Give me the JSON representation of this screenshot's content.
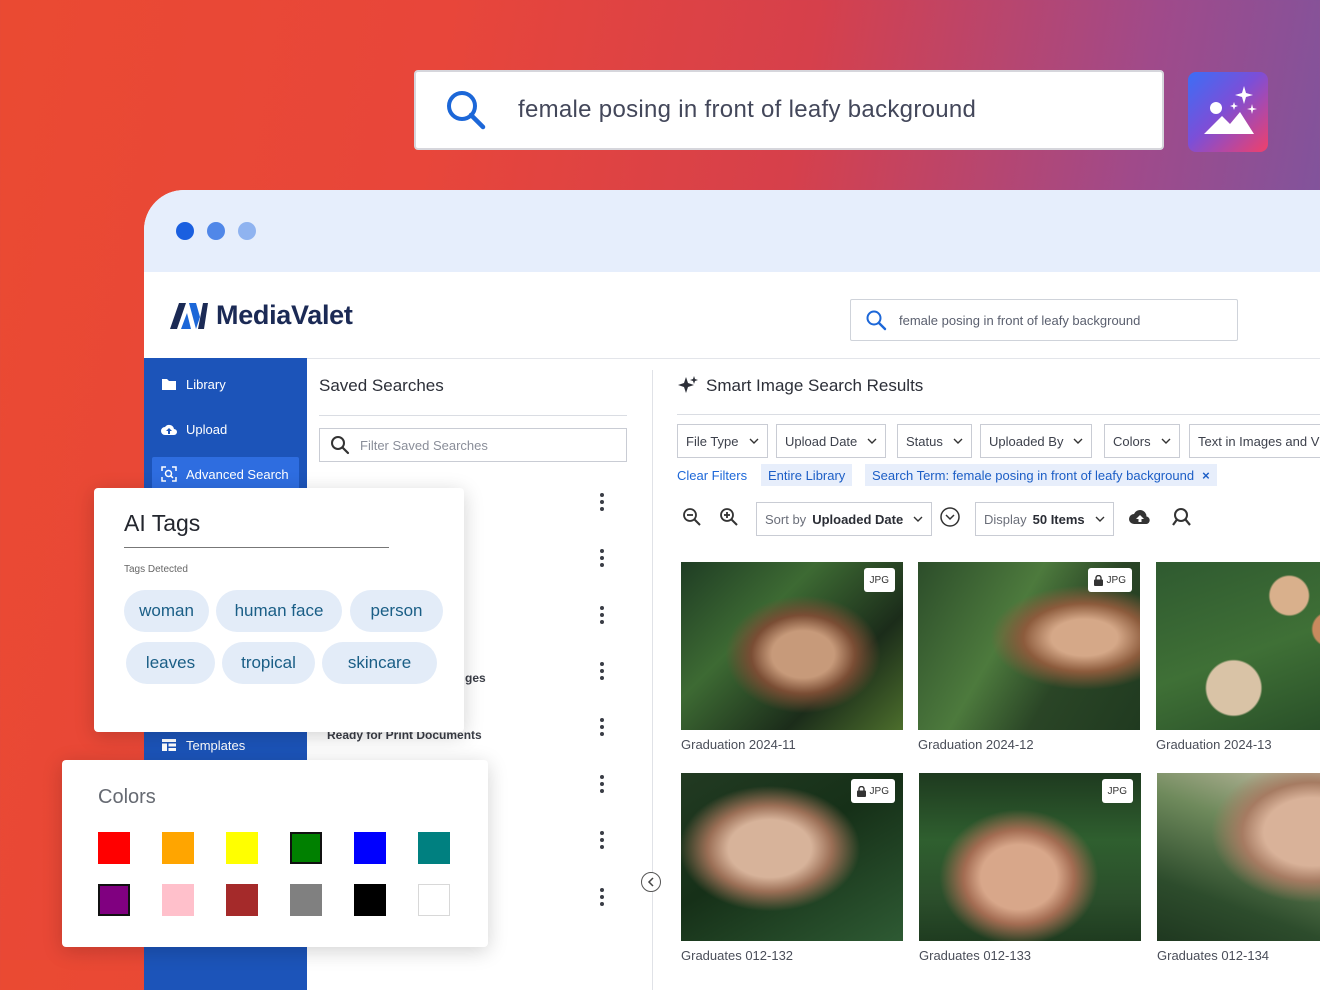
{
  "hero": {
    "search_text": "female posing in front of leafy background",
    "icon": "search-icon",
    "ai_icon": "ai-image-search-icon"
  },
  "window": {
    "dots": [
      "#1a5fe0",
      "#5087e8",
      "#8fb3f0"
    ],
    "brand": "MediaValet",
    "header_search_text": "female posing in front of leafy background"
  },
  "sidebar": {
    "items": [
      {
        "label": "Library",
        "icon": "folder-icon"
      },
      {
        "label": "Upload",
        "icon": "cloud-upload-icon"
      },
      {
        "label": "Advanced Search",
        "icon": "advanced-search-icon"
      },
      {
        "label": "Templates",
        "icon": "templates-icon"
      }
    ]
  },
  "saved": {
    "title": "Saved Searches",
    "filter_placeholder": "Filter Saved Searches",
    "partial_item_1": "ges",
    "partial_item_2": "Ready for Print Documents"
  },
  "results": {
    "title": "Smart Image Search Results",
    "filters": [
      "File Type",
      "Upload Date",
      "Status",
      "Uploaded By",
      "Colors",
      "Text in Images and V"
    ],
    "clear_filters": "Clear Filters",
    "chip_library": "Entire Library",
    "chip_search_term": "Search Term: female posing in front of leafy background",
    "chip_remove": "×",
    "sort_prefix": "Sort by",
    "sort_value": "Uploaded Date",
    "display_prefix": "Display",
    "display_value": "50 Items",
    "assets": [
      {
        "name": "Graduation 2024-11",
        "badge": "JPG",
        "locked": false
      },
      {
        "name": "Graduation 2024-12",
        "badge": "JPG",
        "locked": true
      },
      {
        "name": "Graduation 2024-13",
        "badge": "",
        "locked": false
      },
      {
        "name": "Graduates 012-132",
        "badge": "JPG",
        "locked": true
      },
      {
        "name": "Graduates 012-133",
        "badge": "JPG",
        "locked": false
      },
      {
        "name": "Graduates 012-134",
        "badge": "",
        "locked": false
      }
    ]
  },
  "ai_tags": {
    "title": "AI Tags",
    "subtitle": "Tags Detected",
    "tags": [
      "woman",
      "human face",
      "person",
      "leaves",
      "tropical",
      "skincare"
    ]
  },
  "colors": {
    "title": "Colors",
    "swatches": [
      "#ff0000",
      "#ffa500",
      "#ffff00",
      "#008000",
      "#0000ff",
      "#008080",
      "#800080",
      "#ffc0cb",
      "#a52a2a",
      "#808080",
      "#000000",
      "#ffffff"
    ]
  }
}
